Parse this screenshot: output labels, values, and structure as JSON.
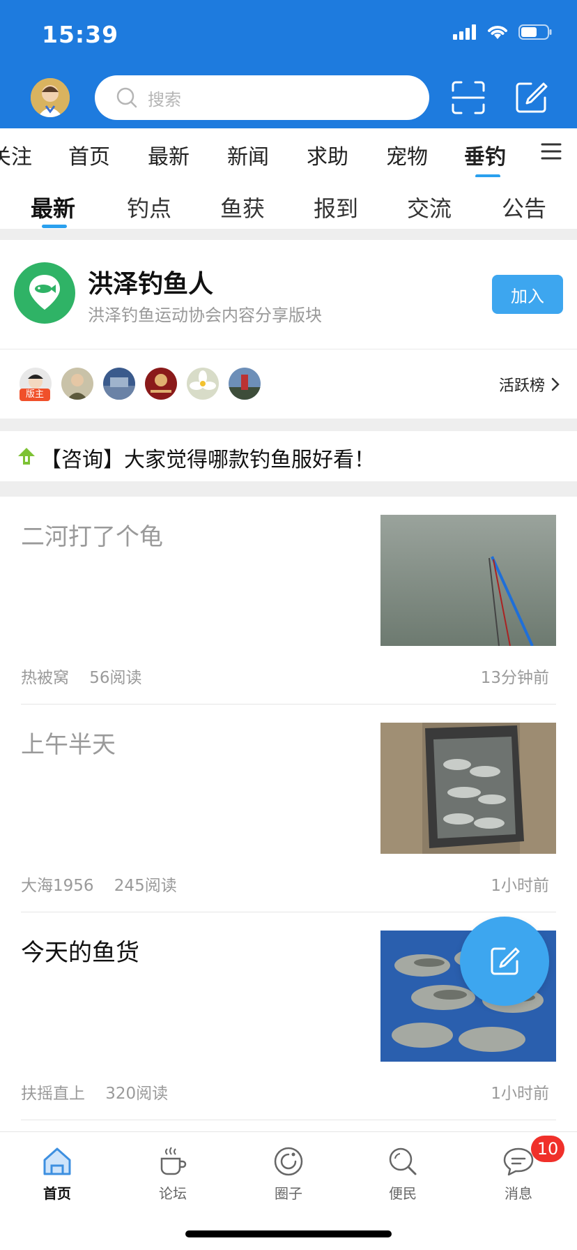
{
  "status_bar": {
    "time": "15:39"
  },
  "header": {
    "search_placeholder": "搜索"
  },
  "channels": [
    {
      "label": "关注",
      "active": false
    },
    {
      "label": "首页",
      "active": false
    },
    {
      "label": "最新",
      "active": false
    },
    {
      "label": "新闻",
      "active": false
    },
    {
      "label": "求助",
      "active": false
    },
    {
      "label": "宠物",
      "active": false
    },
    {
      "label": "垂钓",
      "active": true
    }
  ],
  "subtabs": [
    {
      "label": "最新",
      "active": true
    },
    {
      "label": "钓点",
      "active": false
    },
    {
      "label": "鱼获",
      "active": false
    },
    {
      "label": "报到",
      "active": false
    },
    {
      "label": "交流",
      "active": false
    },
    {
      "label": "公告",
      "active": false
    }
  ],
  "board": {
    "name": "洪泽钓鱼人",
    "description": "洪泽钓鱼运动协会内容分享版块",
    "join_label": "加入",
    "moderator_badge": "版主",
    "rank_label": "活跃榜"
  },
  "pinned": {
    "text": "【咨询】大家觉得哪款钓鱼服好看！"
  },
  "posts": [
    {
      "title": "二河打了个龟",
      "author": "热被窝",
      "reads": "56阅读",
      "time": "13分钟前",
      "read": true,
      "image": "water-fishing-rod"
    },
    {
      "title": "上午半天",
      "author": "大海1956",
      "reads": "245阅读",
      "time": "1小时前",
      "read": true,
      "image": "fish-in-tub"
    },
    {
      "title": "今天的鱼货",
      "author": "扶摇直上",
      "reads": "320阅读",
      "time": "1小时前",
      "read": false,
      "image": "fish-pile"
    }
  ],
  "bottom_nav": [
    {
      "label": "首页",
      "icon": "home-icon",
      "active": true
    },
    {
      "label": "论坛",
      "icon": "coffee-cup-icon",
      "active": false
    },
    {
      "label": "圈子",
      "icon": "circle-icon",
      "active": false
    },
    {
      "label": "便民",
      "icon": "search-icon",
      "active": false
    },
    {
      "label": "消息",
      "icon": "chat-bubble-icon",
      "active": false
    }
  ],
  "message_badge": "10",
  "colors": {
    "header_blue": "#1E7BDE",
    "accent": "#3DA6EF",
    "board_green": "#2FB366",
    "badge_red": "#F0302A"
  }
}
